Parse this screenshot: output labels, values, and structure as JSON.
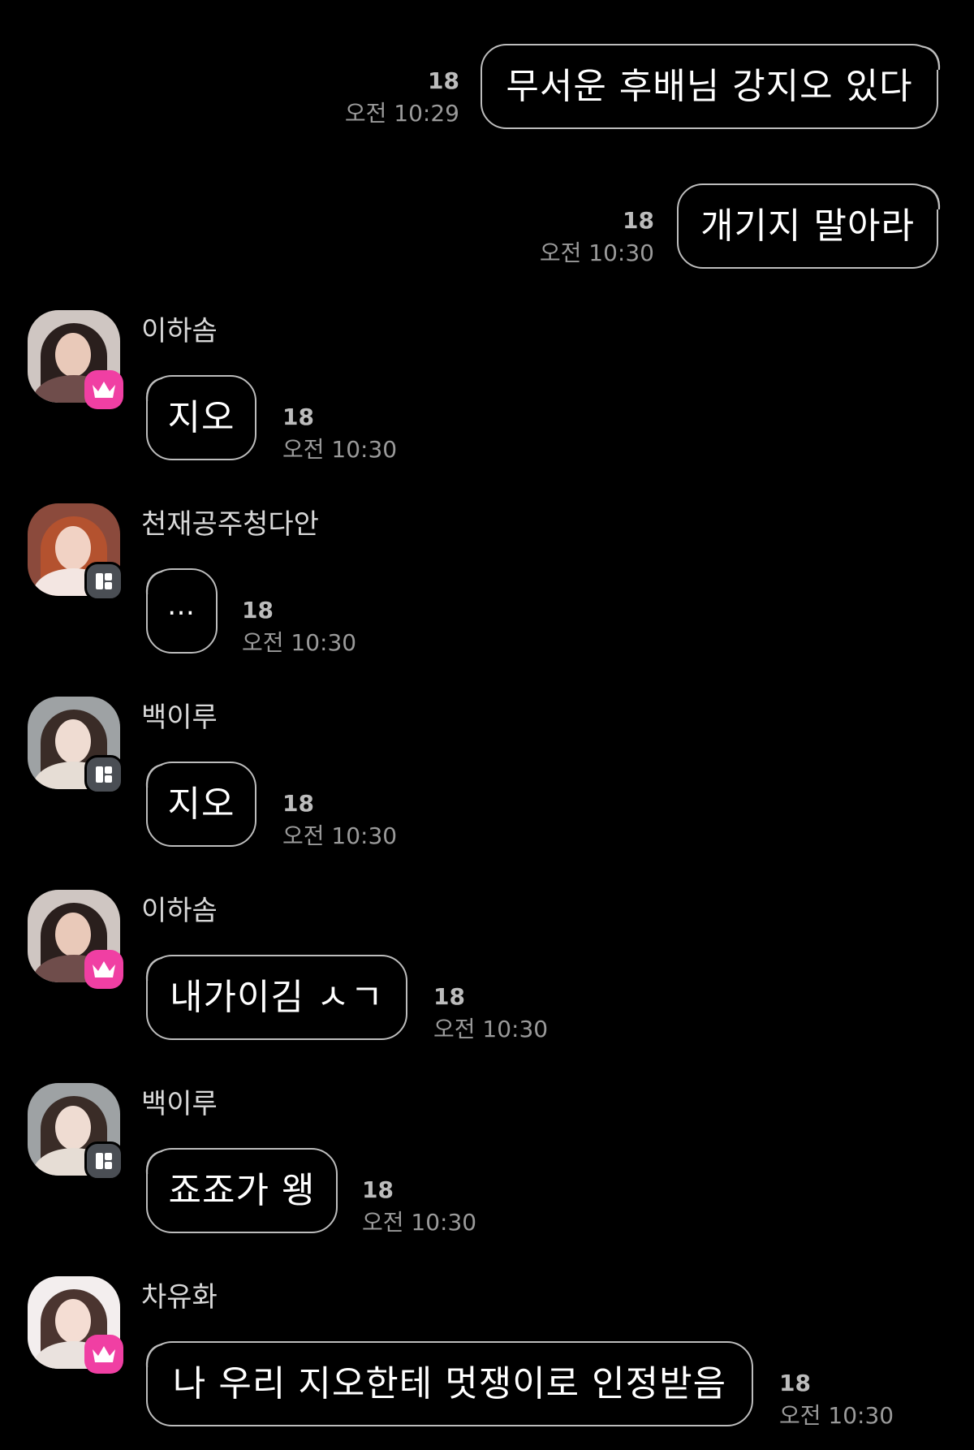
{
  "messages": [
    {
      "direction": "outgoing",
      "text": "무서운 후배님 강지오 있다",
      "count": "18",
      "time": "오전 10:29"
    },
    {
      "direction": "outgoing",
      "text": "개기지 말아라",
      "count": "18",
      "time": "오전 10:30"
    },
    {
      "direction": "incoming",
      "sender": "이하솜",
      "avatar_badge": "crown-icon",
      "text": "지오",
      "count": "18",
      "time": "오전 10:30"
    },
    {
      "direction": "incoming",
      "sender": "천재공주청다안",
      "avatar_badge": "member-icon",
      "text": "…",
      "count": "18",
      "time": "오전 10:30"
    },
    {
      "direction": "incoming",
      "sender": "백이루",
      "avatar_badge": "member-icon",
      "text": "지오",
      "count": "18",
      "time": "오전 10:30"
    },
    {
      "direction": "incoming",
      "sender": "이하솜",
      "avatar_badge": "crown-icon",
      "text": "내가이김 ㅅㄱ",
      "count": "18",
      "time": "오전 10:30"
    },
    {
      "direction": "incoming",
      "sender": "백이루",
      "avatar_badge": "member-icon",
      "text": "죠죠가 왱",
      "count": "18",
      "time": "오전 10:30"
    },
    {
      "direction": "incoming",
      "sender": "차유화",
      "avatar_badge": "crown-icon",
      "text": "나 우리 지오한테 멋쟁이로 인정받음",
      "count": "18",
      "time": "오전 10:30"
    }
  ],
  "colors": {
    "background": "#000000",
    "bubble_border": "#bdbdbd",
    "crown_badge": "#f03fa3",
    "member_badge": "#4a4e54"
  }
}
